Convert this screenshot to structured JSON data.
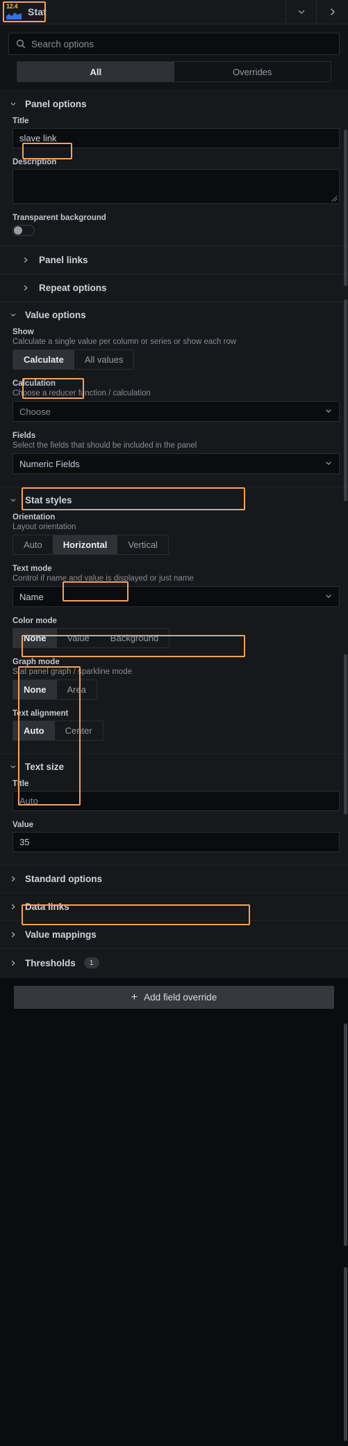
{
  "header": {
    "version_badge": "12.4",
    "viz_name": "Stat",
    "chevron_icon": "chevron-down-icon",
    "next_icon": "chevron-right-icon"
  },
  "search": {
    "placeholder": "Search options",
    "icon": "search-icon",
    "value": ""
  },
  "tabs": [
    {
      "label": "All",
      "active": true
    },
    {
      "label": "Overrides",
      "active": false
    }
  ],
  "panel_options": {
    "title": "Panel options",
    "title_field": {
      "label": "Title",
      "value": "slave link"
    },
    "description_field": {
      "label": "Description",
      "value": ""
    },
    "transparent_background": {
      "label": "Transparent background",
      "enabled": false
    },
    "panel_links": "Panel links",
    "repeat_options": "Repeat options"
  },
  "value_options": {
    "title": "Value options",
    "show": {
      "label": "Show",
      "description": "Calculate a single value per column or series or show each row",
      "options": [
        "Calculate",
        "All values"
      ],
      "selected": "Calculate"
    },
    "calculation": {
      "label": "Calculation",
      "description": "Choose a reducer function / calculation",
      "value": "Choose",
      "is_placeholder": true
    },
    "fields": {
      "label": "Fields",
      "description": "Select the fields that should be included in the panel",
      "value": "Numeric Fields"
    }
  },
  "stat_styles": {
    "title": "Stat styles",
    "orientation": {
      "label": "Orientation",
      "description": "Layout orientation",
      "options": [
        "Auto",
        "Horizontal",
        "Vertical"
      ],
      "selected": "Horizontal"
    },
    "text_mode": {
      "label": "Text mode",
      "description": "Control if name and value is displayed or just name",
      "value": "Name"
    },
    "color_mode": {
      "label": "Color mode",
      "options": [
        "None",
        "Value",
        "Background"
      ],
      "selected": "None"
    },
    "graph_mode": {
      "label": "Graph mode",
      "description": "Stat panel graph / sparkline mode",
      "options": [
        "None",
        "Area"
      ],
      "selected": "None"
    },
    "text_alignment": {
      "label": "Text alignment",
      "options": [
        "Auto",
        "Center"
      ],
      "selected": "Auto"
    }
  },
  "text_size": {
    "title": "Text size",
    "title_field": {
      "label": "Title",
      "value": "",
      "placeholder": "Auto"
    },
    "value_field": {
      "label": "Value",
      "value": "35"
    }
  },
  "collapsed_sections": [
    {
      "label": "Standard options",
      "badge": ""
    },
    {
      "label": "Data links",
      "badge": ""
    },
    {
      "label": "Value mappings",
      "badge": ""
    },
    {
      "label": "Thresholds",
      "badge": "1"
    }
  ],
  "footer": {
    "add_override_label": "Add field override",
    "plus_icon": "plus-icon"
  },
  "colors": {
    "highlight": "#f5a35c",
    "accent_yellow": "#f2c037",
    "icon_blue": "#3274d9",
    "panel_bg": "#16181b",
    "page_bg": "#0b0c0e"
  }
}
